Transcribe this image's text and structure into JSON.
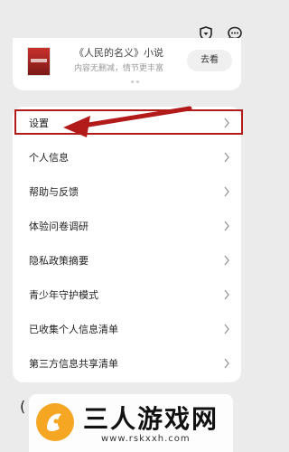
{
  "promo": {
    "title": "《人民的名义》小说",
    "subtitle": "内容无删减，情节更丰富",
    "button": "去看"
  },
  "menu": {
    "items": [
      {
        "label": "设置"
      },
      {
        "label": "个人信息"
      },
      {
        "label": "帮助与反馈"
      },
      {
        "label": "体验问卷调研"
      },
      {
        "label": "隐私政策摘要"
      },
      {
        "label": "青少年守护模式"
      },
      {
        "label": "已收集个人信息清单"
      },
      {
        "label": "第三方信息共享清单"
      }
    ]
  },
  "watermark": {
    "text": "三人游戏网",
    "url": "www.rskxxh.com"
  },
  "bottom_left_char": "(",
  "colors": {
    "highlight": "#b31b1b",
    "arrow": "#b31b1b",
    "logo": "#f5a623"
  },
  "icons": {
    "top_left": "shield-heart-icon",
    "top_right": "chat-bubble-icon"
  }
}
